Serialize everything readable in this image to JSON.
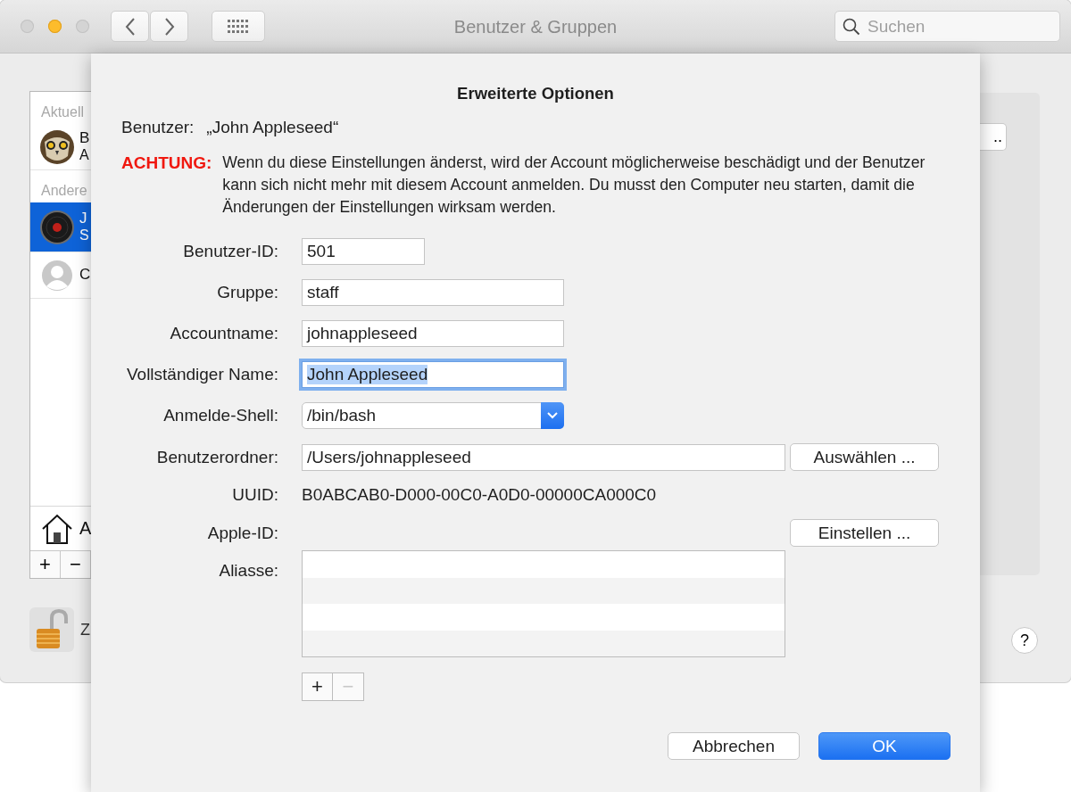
{
  "window": {
    "title": "Benutzer & Gruppen",
    "search": {
      "placeholder": "Suchen"
    }
  },
  "sidebar": {
    "groups": [
      {
        "header": "Aktuell",
        "users": [
          {
            "kind": "owl",
            "line_1": "B",
            "line_2": "A",
            "selected": false
          }
        ]
      },
      {
        "header": "Andere",
        "users": [
          {
            "kind": "record",
            "line_1": "J",
            "line_2": "S",
            "selected": true
          },
          {
            "kind": "silhouette",
            "line_1": "C",
            "selected": false
          }
        ]
      }
    ],
    "footer_item": "A",
    "add_button": "+",
    "remove_button": "−"
  },
  "lock_label": "Z",
  "panel_button": "..",
  "help_button": "?",
  "sheet": {
    "title": "Erweiterte Optionen",
    "user_label": "Benutzer:",
    "user_value": "„John Appleseed“",
    "warning": {
      "label": "ACHTUNG:",
      "text": "Wenn du diese Einstellungen änderst, wird der Account möglicherweise beschädigt und der Benutzer kann sich nicht mehr mit diesem Account anmelden. Du musst den Computer neu starten, damit die Änderungen der Einstellungen wirksam werden."
    },
    "fields": [
      {
        "kind": "short",
        "label": "Benutzer-ID:",
        "value": "501",
        "focused": false
      },
      {
        "kind": "text",
        "label": "Gruppe:",
        "value": "staff",
        "focused": false
      },
      {
        "kind": "text",
        "label": "Accountname:",
        "value": "johnappleseed",
        "focused": false
      },
      {
        "kind": "text",
        "label": "Vollständiger Name:",
        "value": "John Appleseed",
        "focused": true
      },
      {
        "kind": "popup",
        "label": "Anmelde-Shell:",
        "value": "/bin/bash"
      },
      {
        "kind": "path",
        "label": "Benutzerordner:",
        "value": "/Users/johnappleseed",
        "button": "Auswählen ..."
      },
      {
        "kind": "info",
        "label": "UUID:",
        "value": "B0ABCAB0-D000-00C0-A0D0-00000CA000C0"
      },
      {
        "kind": "action",
        "label": "Apple-ID:",
        "button": "Einstellen ..."
      },
      {
        "kind": "list",
        "label": "Aliasse:"
      }
    ],
    "alias_buttons": [
      {
        "label": "+",
        "disabled": false
      },
      {
        "label": "−",
        "disabled": true
      }
    ],
    "buttons": [
      {
        "label": "Abbrechen",
        "default": false
      },
      {
        "label": "OK",
        "default": true
      }
    ]
  }
}
